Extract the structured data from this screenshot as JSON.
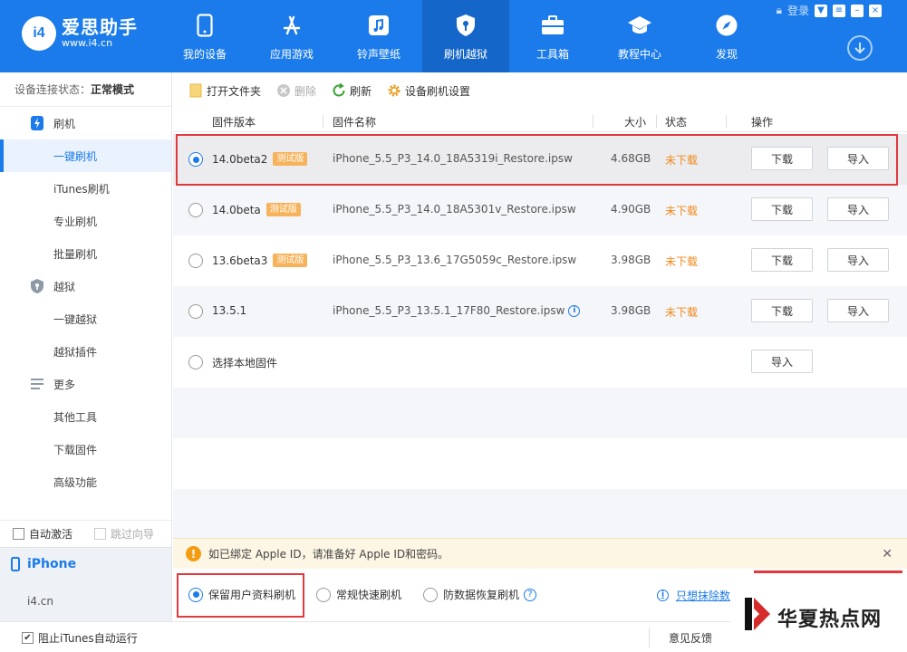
{
  "app": {
    "logo_badge": "i4",
    "logo_name": "爱思助手",
    "logo_url": "www.i4.cn",
    "login": "登录"
  },
  "nav": [
    {
      "label": "我的设备",
      "icon": "phone-icon"
    },
    {
      "label": "应用游戏",
      "icon": "app-store-icon"
    },
    {
      "label": "铃声壁纸",
      "icon": "music-icon"
    },
    {
      "label": "刷机越狱",
      "icon": "shield-key-icon",
      "active": true
    },
    {
      "label": "工具箱",
      "icon": "toolbox-icon"
    },
    {
      "label": "教程中心",
      "icon": "graduation-cap-icon"
    },
    {
      "label": "发现",
      "icon": "compass-icon"
    }
  ],
  "sidebar": {
    "status_label": "设备连接状态：",
    "status_value": "正常模式",
    "groups": [
      {
        "label": "刷机",
        "icon": "flash-icon"
      },
      {
        "label": "越狱",
        "icon": "shield-icon"
      },
      {
        "label": "更多",
        "icon": "menu-icon"
      }
    ],
    "items": [
      "一键刷机",
      "iTunes刷机",
      "专业刷机",
      "批量刷机",
      "一键越狱",
      "越狱插件",
      "其他工具",
      "下载固件",
      "高级功能"
    ],
    "auto_activate": "自动激活",
    "skip_guide": "跳过向导",
    "device_name": "iPhone",
    "device_url": "i4.cn"
  },
  "toolbar": {
    "open_folder": "打开文件夹",
    "delete": "删除",
    "refresh": "刷新",
    "settings": "设备刷机设置"
  },
  "table": {
    "headers": {
      "version": "固件版本",
      "name": "固件名称",
      "size": "大小",
      "status": "状态",
      "action": "操作"
    },
    "beta_tag": "测试版",
    "download_label": "下载",
    "import_label": "导入",
    "rows": [
      {
        "version": "14.0beta2",
        "beta": true,
        "name": "iPhone_5.5_P3_14.0_18A5319i_Restore.ipsw",
        "size": "4.68GB",
        "status": "未下载",
        "selected": true
      },
      {
        "version": "14.0beta",
        "beta": true,
        "name": "iPhone_5.5_P3_14.0_18A5301v_Restore.ipsw",
        "size": "4.90GB",
        "status": "未下载"
      },
      {
        "version": "13.6beta3",
        "beta": true,
        "name": "iPhone_5.5_P3_13.6_17G5059c_Restore.ipsw",
        "size": "3.98GB",
        "status": "未下载"
      },
      {
        "version": "13.5.1",
        "beta": false,
        "name": "iPhone_5.5_P3_13.5.1_17F80_Restore.ipsw",
        "size": "3.98GB",
        "status": "未下载",
        "info": true
      }
    ],
    "local_label": "选择本地固件"
  },
  "notice": "如已绑定 Apple ID，请准备好 Apple ID和密码。",
  "modes": {
    "keep_data": "保留用户资料刷机",
    "quick": "常规快速刷机",
    "anti_loss": "防数据恢复刷机",
    "erase_link": "只想抹除数"
  },
  "footer": {
    "block_itunes": "阻止iTunes自动运行",
    "feedback": "意见反馈"
  },
  "watermark": "华夏热点网",
  "colors": {
    "brand": "#1b7bea",
    "status_orange": "#f0881b",
    "highlight_red": "#e0393e",
    "beta_tag": "#f7b35b"
  }
}
